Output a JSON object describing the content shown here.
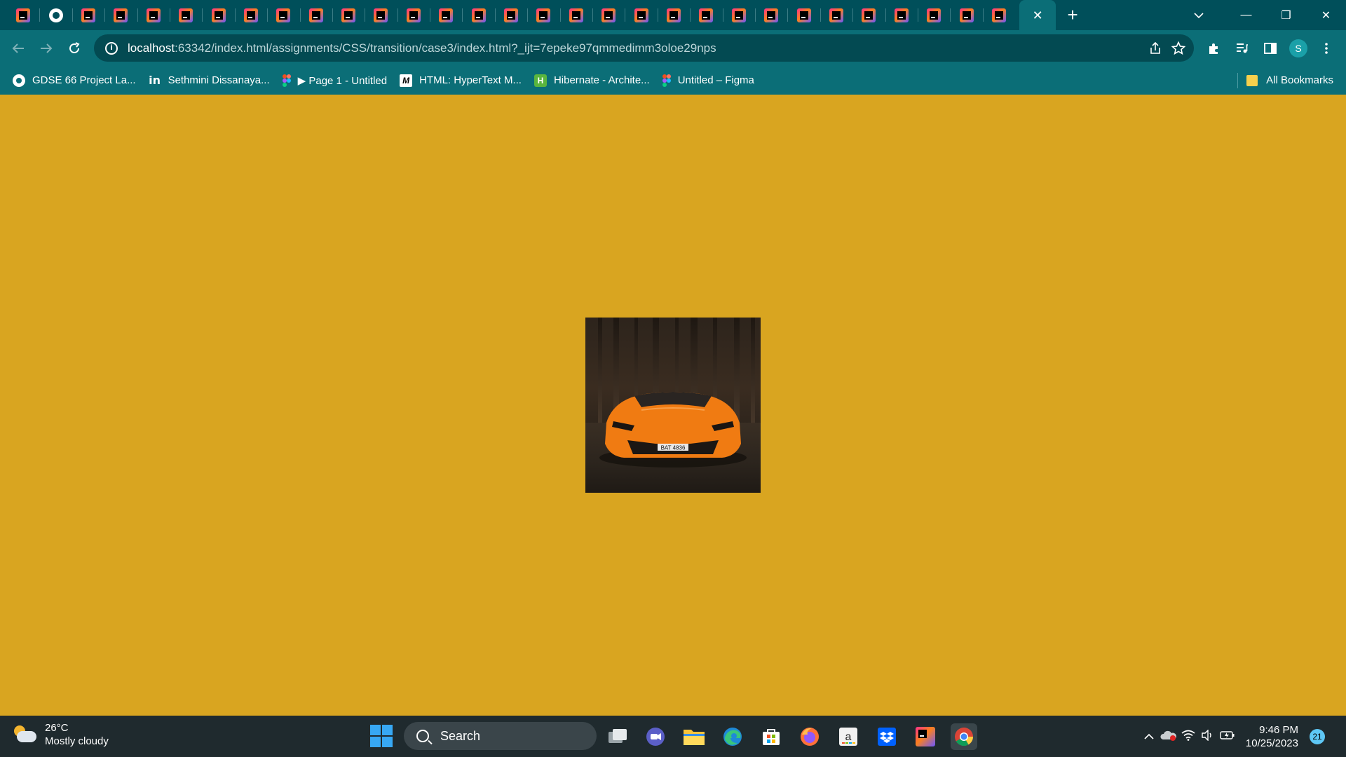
{
  "browser": {
    "tab_count_ij": 30,
    "tab_close": "✕",
    "new_tab": "+",
    "window": {
      "minimize": "—",
      "restore": "❐",
      "close": "✕"
    },
    "tab_search_icon": "chevron-down-icon"
  },
  "toolbar": {
    "url_host": "localhost",
    "url_rest": ":63342/index.html/assignments/CSS/transition/case3/index.html?_ijt=7epeke97qmmedimm3oloe29nps",
    "profile_initial": "S"
  },
  "bookmarks": {
    "items": [
      {
        "label": "GDSE 66 Project La...",
        "icon": "github-icon"
      },
      {
        "label": "Sethmini Dissanaya...",
        "icon": "linkedin-icon"
      },
      {
        "label": "▶ Page 1 - Untitled",
        "icon": "figma-icon"
      },
      {
        "label": "HTML: HyperText M...",
        "icon": "mdn-icon"
      },
      {
        "label": "Hibernate - Archite...",
        "icon": "hibernate-icon"
      },
      {
        "label": "Untitled – Figma",
        "icon": "figma-icon"
      }
    ],
    "all_bookmarks": "All Bookmarks"
  },
  "page": {
    "background": "#d9a520",
    "image_description_plate": "BAT 4836"
  },
  "taskbar": {
    "weather_temp": "26°C",
    "weather_desc": "Mostly cloudy",
    "search_label": "Search",
    "time": "9:46 PM",
    "date": "10/25/2023",
    "notification_count": "21"
  }
}
